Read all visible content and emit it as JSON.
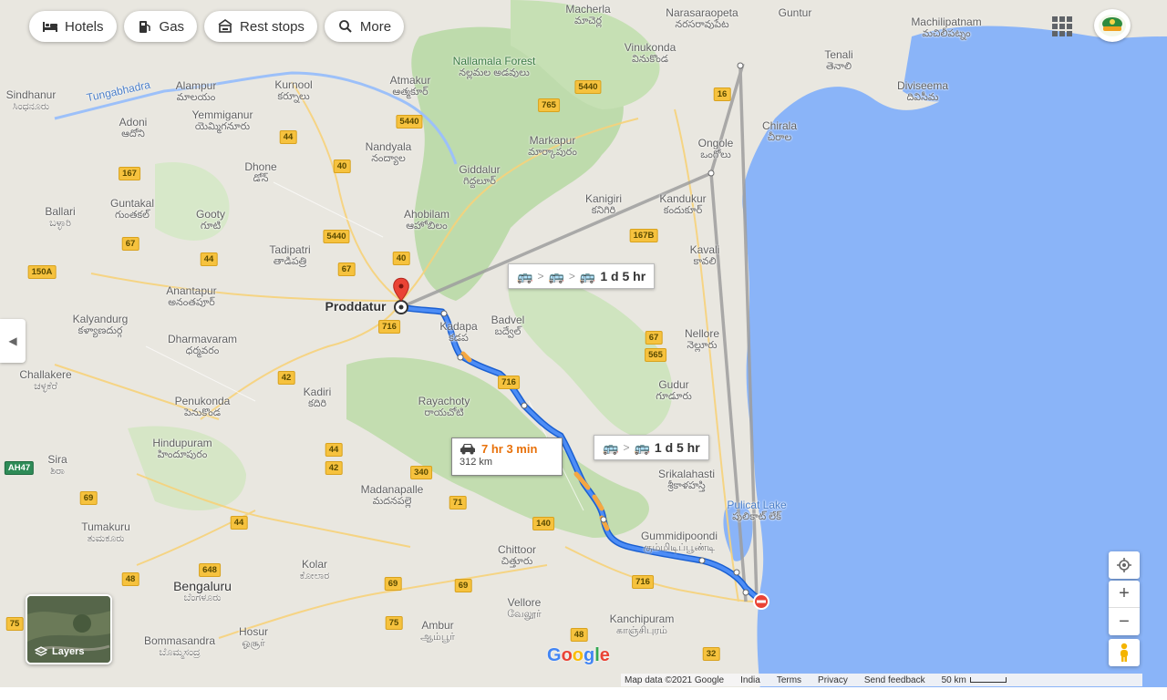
{
  "chips": [
    {
      "label": "Hotels",
      "icon": "bed-icon"
    },
    {
      "label": "Gas",
      "icon": "gas-station-icon"
    },
    {
      "label": "Rest stops",
      "icon": "rest-stop-icon"
    },
    {
      "label": "More",
      "icon": "search-icon"
    }
  ],
  "places": [
    {
      "name": "Macherla",
      "sub": "మాచెర్ల",
      "kind": "normal"
    },
    {
      "name": "Narasaraopeta",
      "sub": "నరసరావుపేట",
      "kind": "normal"
    },
    {
      "name": "Guntur",
      "sub": "గుంటూరు",
      "kind": "normal"
    },
    {
      "name": "Machilipatnam",
      "sub": "మచిలీపట్నం",
      "kind": "normal"
    },
    {
      "name": "Vinukonda",
      "sub": "వినుకొండ",
      "kind": "normal"
    },
    {
      "name": "Tenali",
      "sub": "తెనాలి",
      "kind": "normal"
    },
    {
      "name": "Diviseema",
      "sub": "దివిసీమ",
      "kind": "normal"
    },
    {
      "name": "Nallamala Forest",
      "sub": "నల్లమల అడవులు",
      "kind": "forest"
    },
    {
      "name": "Atmakur",
      "sub": "ఆత్మకూర్",
      "kind": "normal"
    },
    {
      "name": "Kurnool",
      "sub": "కర్నూలు",
      "kind": "normal"
    },
    {
      "name": "Alampur",
      "sub": "మాలయం",
      "kind": "normal"
    },
    {
      "name": "Sindhanur",
      "sub": "ಸಿಂಧನೂರು",
      "kind": "normal"
    },
    {
      "name": "Tungabhadra",
      "sub": "",
      "kind": "water"
    },
    {
      "name": "Yemmiganur",
      "sub": "యెమ్మిగనూరు",
      "kind": "normal"
    },
    {
      "name": "Adoni",
      "sub": "ఆదోని",
      "kind": "normal"
    },
    {
      "name": "Nandyala",
      "sub": "నంద్యాల",
      "kind": "normal"
    },
    {
      "name": "Markapur",
      "sub": "మార్కాపురం",
      "kind": "normal"
    },
    {
      "name": "Chirala",
      "sub": "చీరాల",
      "kind": "normal"
    },
    {
      "name": "Ongole",
      "sub": "ఒంగోలు",
      "kind": "normal"
    },
    {
      "name": "Giddalur",
      "sub": "గిద్దలూర్",
      "kind": "normal"
    },
    {
      "name": "Dhone",
      "sub": "డోన్",
      "kind": "normal"
    },
    {
      "name": "Guntakal",
      "sub": "గుంతకల్",
      "kind": "normal"
    },
    {
      "name": "Gooty",
      "sub": "గూటి",
      "kind": "normal"
    },
    {
      "name": "Ballari",
      "sub": "ಬಳ್ಳಾರಿ",
      "kind": "normal"
    },
    {
      "name": "Kanigiri",
      "sub": "కనిగిరి",
      "kind": "normal"
    },
    {
      "name": "Kandukur",
      "sub": "కందుకూర్",
      "kind": "normal"
    },
    {
      "name": "Ahobilam",
      "sub": "ఆహోబిలం",
      "kind": "normal"
    },
    {
      "name": "Tadipatri",
      "sub": "తాడిపత్రి",
      "kind": "normal"
    },
    {
      "name": "Kavali",
      "sub": "కావలి",
      "kind": "normal"
    },
    {
      "name": "Anantapur",
      "sub": "అనంతపూర్",
      "kind": "normal"
    },
    {
      "name": "Proddatur",
      "sub": "",
      "kind": "big"
    },
    {
      "name": "Kadapa",
      "sub": "కడప",
      "kind": "normal"
    },
    {
      "name": "Badvel",
      "sub": "బద్వేల్",
      "kind": "normal"
    },
    {
      "name": "Kalyandurg",
      "sub": "కళ్యాణదుర్గ",
      "kind": "normal"
    },
    {
      "name": "Dharmavaram",
      "sub": "ధర్మవరం",
      "kind": "normal"
    },
    {
      "name": "Nellore",
      "sub": "నెల్లూరు",
      "kind": "normal"
    },
    {
      "name": "Challakere",
      "sub": "ಚಳ್ಳಕೆರೆ",
      "kind": "normal"
    },
    {
      "name": "Gudur",
      "sub": "గూడూరు",
      "kind": "normal"
    },
    {
      "name": "Kadiri",
      "sub": "కదిరి",
      "kind": "normal"
    },
    {
      "name": "Rayachoty",
      "sub": "రాయచోటి",
      "kind": "normal"
    },
    {
      "name": "Penukonda",
      "sub": "పెనుకొండ",
      "kind": "normal"
    },
    {
      "name": "Hindupuram",
      "sub": "హిందూపురం",
      "kind": "normal"
    },
    {
      "name": "Sira",
      "sub": "ಶಿರಾ",
      "kind": "normal"
    },
    {
      "name": "Srikalahasti",
      "sub": "శ్రీకాళహస్తి",
      "kind": "normal"
    },
    {
      "name": "Pulicat Lake",
      "sub": "పులికాట్ లేక్",
      "kind": "water"
    },
    {
      "name": "Madanapalle",
      "sub": "మదనపల్లె",
      "kind": "normal"
    },
    {
      "name": "Gummidipoondi",
      "sub": "கும்மிடிப்பூண்டி",
      "kind": "normal"
    },
    {
      "name": "Tumakuru",
      "sub": "ತುಮಕೂರು",
      "kind": "normal"
    },
    {
      "name": "Chittoor",
      "sub": "చిత్తూరు",
      "kind": "normal"
    },
    {
      "name": "Kolar",
      "sub": "ಕೋಲಾರ",
      "kind": "normal"
    },
    {
      "name": "Bengaluru",
      "sub": "ಬೆಂಗಳೂರು",
      "kind": "big"
    },
    {
      "name": "Vellore",
      "sub": "வேலூர்",
      "kind": "normal"
    },
    {
      "name": "Kanchipuram",
      "sub": "காஞ்சிபுரம்",
      "kind": "normal"
    },
    {
      "name": "Ambur",
      "sub": "ஆம்பூர்",
      "kind": "normal"
    },
    {
      "name": "Hosur",
      "sub": "ஓசூர்",
      "kind": "normal"
    },
    {
      "name": "Bommasandra",
      "sub": "ಬೊಮ್ಮಸಂದ್ರ",
      "kind": "normal"
    }
  ],
  "shields": [
    {
      "label": "5440",
      "kind": "yellow"
    },
    {
      "label": "765",
      "kind": "yellow"
    },
    {
      "label": "16",
      "kind": "yellow"
    },
    {
      "label": "5440",
      "kind": "yellow"
    },
    {
      "label": "44",
      "kind": "yellow"
    },
    {
      "label": "40",
      "kind": "yellow"
    },
    {
      "label": "167",
      "kind": "yellow"
    },
    {
      "label": "5440",
      "kind": "yellow"
    },
    {
      "label": "40",
      "kind": "yellow"
    },
    {
      "label": "167B",
      "kind": "yellow"
    },
    {
      "label": "67",
      "kind": "yellow"
    },
    {
      "label": "44",
      "kind": "yellow"
    },
    {
      "label": "67",
      "kind": "yellow"
    },
    {
      "label": "150A",
      "kind": "yellow"
    },
    {
      "label": "716",
      "kind": "yellow"
    },
    {
      "label": "67",
      "kind": "yellow"
    },
    {
      "label": "565",
      "kind": "yellow"
    },
    {
      "label": "42",
      "kind": "yellow"
    },
    {
      "label": "716",
      "kind": "yellow"
    },
    {
      "label": "44",
      "kind": "yellow"
    },
    {
      "label": "42",
      "kind": "yellow"
    },
    {
      "label": "340",
      "kind": "yellow"
    },
    {
      "label": "AH47",
      "kind": "green"
    },
    {
      "label": "69",
      "kind": "yellow"
    },
    {
      "label": "71",
      "kind": "yellow"
    },
    {
      "label": "140",
      "kind": "yellow"
    },
    {
      "label": "44",
      "kind": "yellow"
    },
    {
      "label": "648",
      "kind": "yellow"
    },
    {
      "label": "48",
      "kind": "yellow"
    },
    {
      "label": "69",
      "kind": "yellow"
    },
    {
      "label": "69",
      "kind": "yellow"
    },
    {
      "label": "716",
      "kind": "yellow"
    },
    {
      "label": "75",
      "kind": "yellow"
    },
    {
      "label": "75",
      "kind": "yellow"
    },
    {
      "label": "48",
      "kind": "yellow"
    },
    {
      "label": "32",
      "kind": "yellow"
    }
  ],
  "route_cards": [
    {
      "label": "1 d 5 hr"
    },
    {
      "label": "1 d 5 hr"
    }
  ],
  "drive": {
    "time": "7 hr 3 min",
    "distance": "312 km"
  },
  "origin_label": "Proddatur",
  "layers_label": "Layers",
  "collapse_icon": "◀",
  "zoom_in": "+",
  "zoom_out": "−",
  "google": [
    "G",
    "o",
    "o",
    "g",
    "l",
    "e"
  ],
  "footer": {
    "map_data": "Map data ©2021 Google",
    "india": "India",
    "terms": "Terms",
    "privacy": "Privacy",
    "feedback": "Send feedback",
    "scale": "50 km"
  },
  "colors": {
    "sea": "#8ab4f8",
    "land": "#e8e6df",
    "forest": "#a8cf94",
    "route": "#4285f4",
    "route_slow": "#f4a742",
    "transit_line": "#9e9e9e",
    "destination": "#ea4335"
  }
}
